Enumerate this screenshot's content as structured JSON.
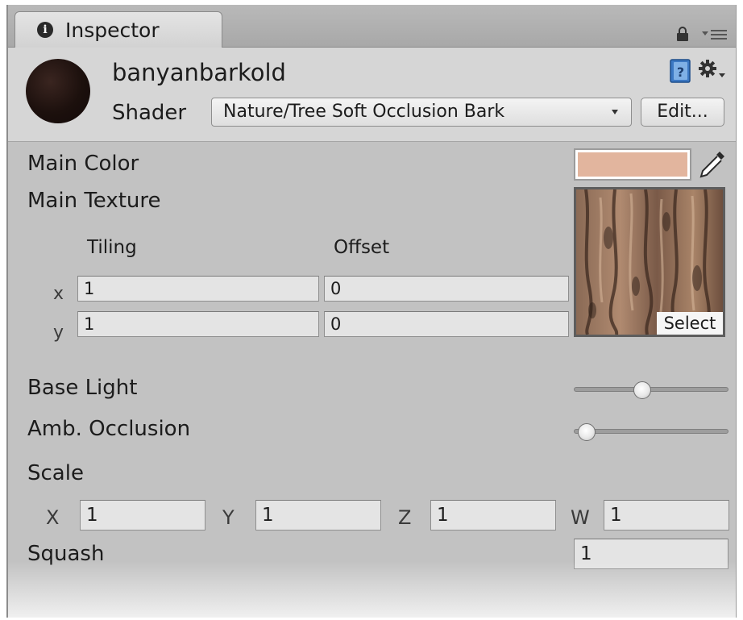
{
  "tab": {
    "title": "Inspector",
    "info_icon": "i"
  },
  "material": {
    "name": "banyanbarkold",
    "shader_label": "Shader",
    "shader_value": "Nature/Tree Soft Occlusion Bark",
    "edit_label": "Edit..."
  },
  "main_color": {
    "label": "Main Color",
    "color": "#e2b59e"
  },
  "main_texture": {
    "label": "Main Texture",
    "tiling_label": "Tiling",
    "offset_label": "Offset",
    "x_label": "x",
    "y_label": "y",
    "tiling_x": "1",
    "tiling_y": "1",
    "offset_x": "0",
    "offset_y": "0",
    "select_label": "Select"
  },
  "base_light": {
    "label": "Base Light",
    "value_fraction": 0.44
  },
  "amb_occlusion": {
    "label": "Amb. Occlusion",
    "value_fraction": 0.08
  },
  "scale": {
    "label": "Scale",
    "x_label": "X",
    "x_value": "1",
    "y_label": "Y",
    "y_value": "1",
    "z_label": "Z",
    "z_value": "1",
    "w_label": "W",
    "w_value": "1"
  },
  "squash": {
    "label": "Squash",
    "value": "1"
  },
  "colors": {
    "window_bg": "#c2c2c2",
    "header_bg": "#d6d6d6",
    "field_bg": "#e4e4e4"
  },
  "icons": [
    "info-icon",
    "lock-icon",
    "menu-icon",
    "help-book-icon",
    "gear-icon",
    "eyedropper-icon"
  ]
}
